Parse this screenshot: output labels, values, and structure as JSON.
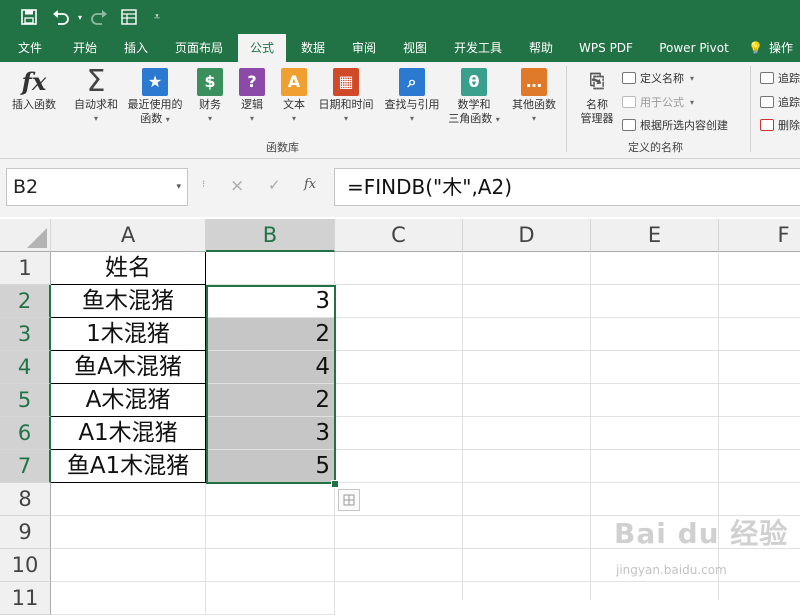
{
  "quick_access": {
    "save_icon": "save-icon",
    "undo_icon": "undo-icon",
    "redo_icon": "redo-icon",
    "form_icon": "form-icon",
    "more_icon": "customize-icon"
  },
  "tabs": [
    "文件",
    "开始",
    "插入",
    "页面布局",
    "公式",
    "数据",
    "审阅",
    "视图",
    "开发工具",
    "帮助",
    "WPS PDF",
    "Power Pivot",
    "操作"
  ],
  "active_tab": "公式",
  "ribbon": {
    "function_library": {
      "label": "函数库",
      "buttons": [
        {
          "label": "插入函数"
        },
        {
          "label": "自动求和"
        },
        {
          "label1": "最近使用的",
          "label2": "函数"
        },
        {
          "label": "财务"
        },
        {
          "label": "逻辑"
        },
        {
          "label": "文本"
        },
        {
          "label": "日期和时间"
        },
        {
          "label": "查找与引用"
        },
        {
          "label1": "数学和",
          "label2": "三角函数"
        },
        {
          "label": "其他函数"
        }
      ]
    },
    "defined_names": {
      "label": "定义的名称",
      "name_manager_1": "名称",
      "name_manager_2": "管理器",
      "define_name": "定义名称",
      "use_in_formula": "用于公式",
      "create_from_selection": "根据所选内容创建"
    },
    "formula_auditing": {
      "trace_precedents": "追踪",
      "trace_dependents": "追踪",
      "remove_arrows": "删除"
    }
  },
  "formula_bar": {
    "name_box": "B2",
    "formula": "=FINDB(\"木\",A2)",
    "cancel": "×",
    "enter": "✓",
    "fx": "fx"
  },
  "columns": [
    "A",
    "B",
    "C",
    "D",
    "E",
    "F"
  ],
  "rows": [
    "1",
    "2",
    "3",
    "4",
    "5",
    "6",
    "7",
    "8",
    "9",
    "10",
    "11"
  ],
  "cells": {
    "A": [
      "姓名",
      "鱼木混猪",
      "1木混猪",
      "鱼A木混猪",
      "A木混猪",
      "A1木混猪",
      "鱼A1木混猪"
    ],
    "B": [
      "",
      "3",
      "2",
      "4",
      "2",
      "3",
      "5"
    ]
  },
  "watermark": {
    "text": "Bai du 经验",
    "url": "jingyan.baidu.com"
  }
}
